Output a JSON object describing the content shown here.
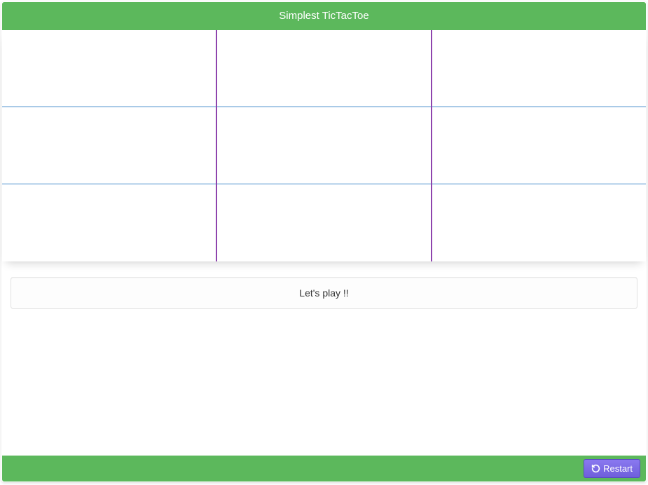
{
  "header": {
    "title": "Simplest TicTacToe"
  },
  "board": {
    "cells": [
      [
        "",
        "",
        ""
      ],
      [
        "",
        "",
        ""
      ],
      [
        "",
        "",
        ""
      ]
    ]
  },
  "message": {
    "text": "Let's play !!"
  },
  "footer": {
    "restart_label": "Restart"
  }
}
